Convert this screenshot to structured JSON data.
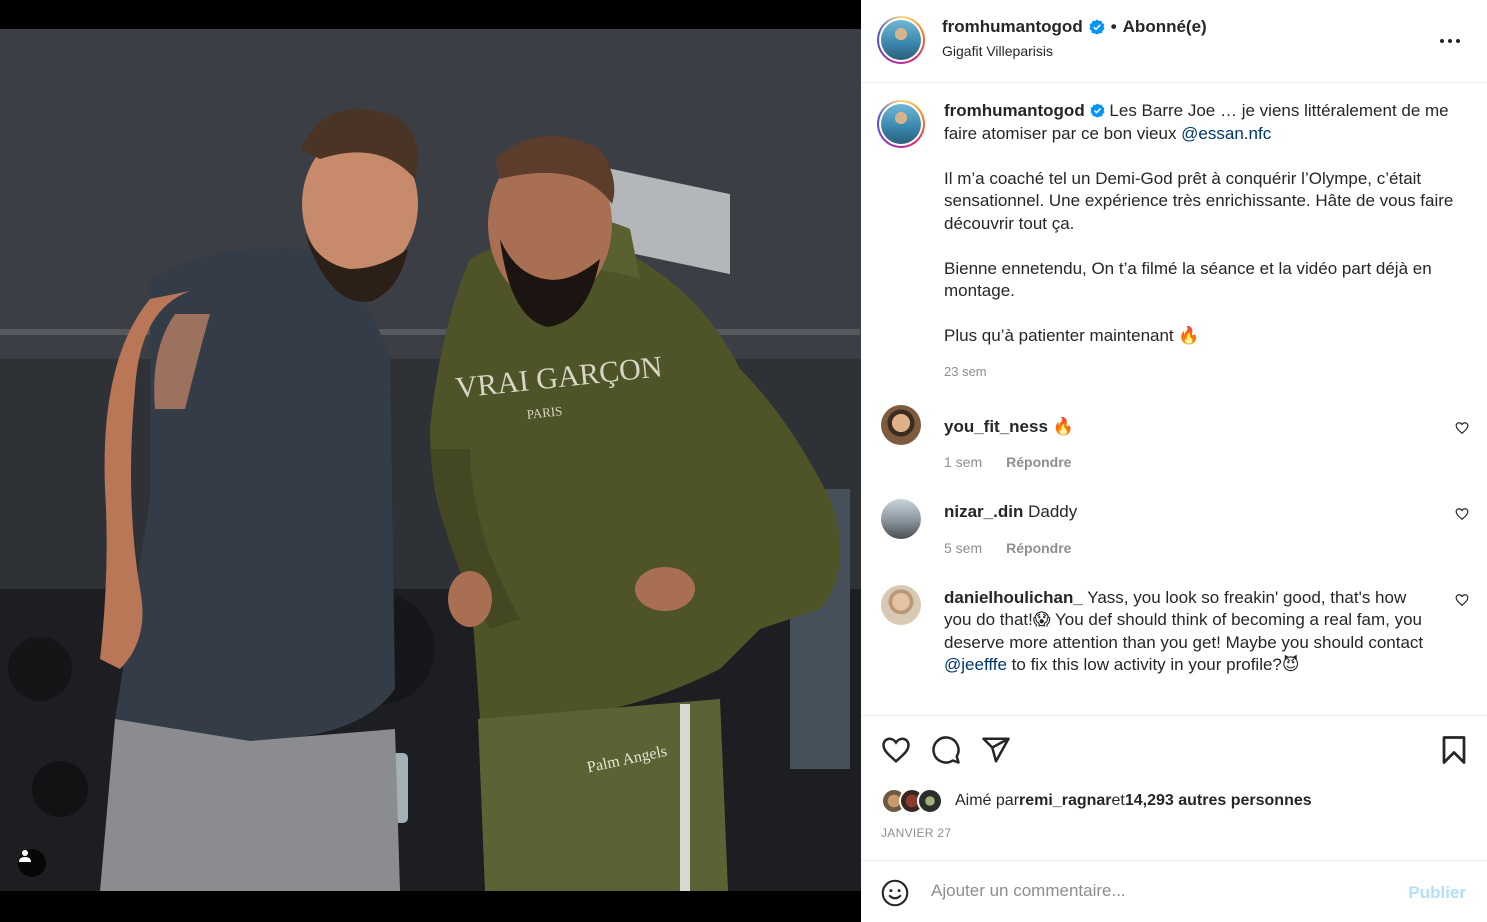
{
  "post": {
    "username": "fromhumantogod",
    "follow_status": "Abonné(e)",
    "separator": "•",
    "location": "Gigafit Villeparisis"
  },
  "caption": {
    "username": "fromhumantogod",
    "line1": " Les Barre Joe … je viens littéralement de me faire atomiser par ce bon vieux ",
    "mention": "@essan.nfc",
    "para2": "Il m’a coaché tel un Demi-God prêt à conquérir l’Olympe, c’était sensationnel. Une expérience très enrichissante. Hâte de vous faire découvrir tout ça.",
    "para3": "Bienne ennetendu, On t’a filmé la séance et la vidéo part déjà en montage.",
    "para4": "Plus qu’à patienter maintenant 🔥",
    "time": "23 sem"
  },
  "comments": [
    {
      "username": "you_fit_ness",
      "text": " 🔥",
      "time": "1 sem",
      "reply": "Répondre"
    },
    {
      "username": "nizar_.din",
      "text": " Daddy",
      "time": "5 sem",
      "reply": "Répondre"
    },
    {
      "username": "danielhoulichan_",
      "text_a": " Yass, you look so freakin' good, that's how you do that!😱 You def should think of becoming a real fam, you deserve more attention than you get! Maybe you should contact ",
      "mention": "@jeefffe",
      "text_b": " to fix this low activity in your profile?😈"
    }
  ],
  "likes": {
    "prefix": "Aimé par ",
    "user": "remi_ragnar",
    "middle": " et ",
    "count": "14,293 autres personnes"
  },
  "date": "JANVIER 27",
  "add_comment": {
    "placeholder": "Ajouter un commentaire...",
    "publish": "Publier"
  },
  "photo": {
    "hoodie_text": "VRAI GARÇON",
    "hoodie_sub": "PARIS",
    "pants_text": "Palm Angels"
  },
  "colors": {
    "verified": "#0095f6",
    "mention": "#00376b",
    "publish_disabled": "#b2dffc",
    "hoodie": "#4e5428"
  }
}
